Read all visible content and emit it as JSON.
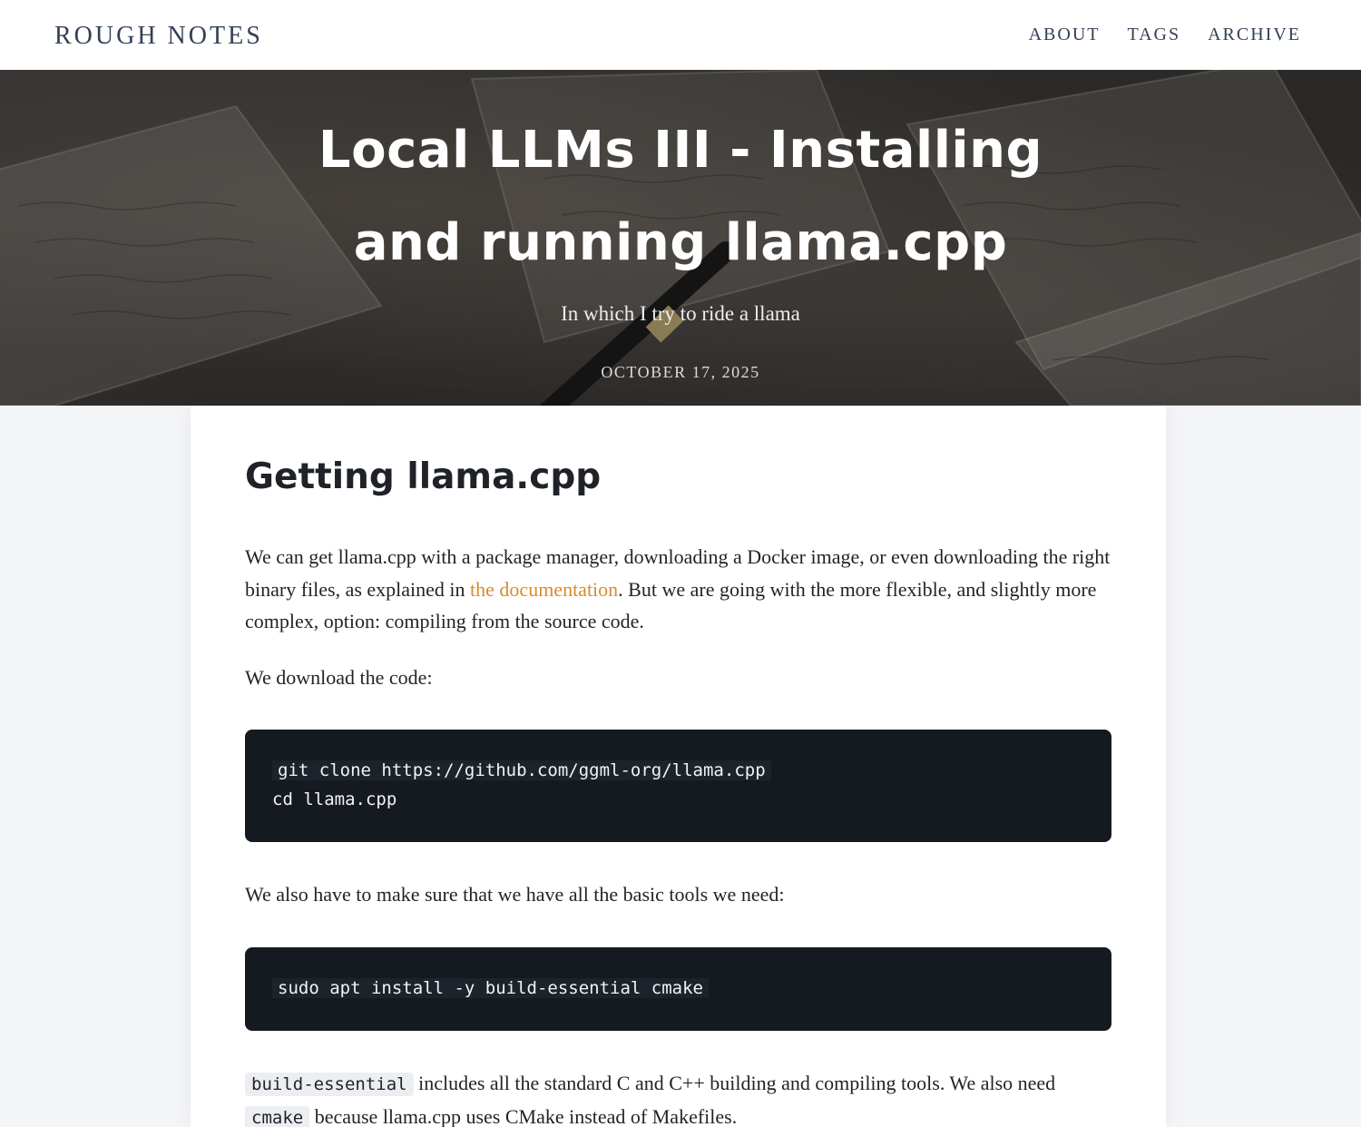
{
  "nav": {
    "brand": "ROUGH NOTES",
    "links": [
      "ABOUT",
      "TAGS",
      "ARCHIVE"
    ]
  },
  "hero": {
    "title_line1": "Local LLMs III - Installing",
    "title_line2": "and running llama.cpp",
    "subtitle": "In which I try to ride a llama",
    "date": "OCTOBER 17, 2025"
  },
  "article": {
    "heading": "Getting llama.cpp",
    "para1_before": "We can get llama.cpp with a package manager, downloading a Docker image, or even downloading the right binary files, as explained in ",
    "para1_link": "the documentation",
    "para1_after": ". But we are going with the more flexible, and slightly more complex, option: compiling from the source code.",
    "para2": "We download the code:",
    "code1": [
      "git clone https://github.com/ggml-org/llama.cpp",
      "cd llama.cpp"
    ],
    "para3": "We also have to make sure that we have all the basic tools we need:",
    "code2": [
      "sudo apt install -y build-essential cmake"
    ],
    "para4_code1": "build-essential",
    "para4_text1": " includes all the standard C and C++ building and compiling tools. We also need ",
    "para4_code2": "cmake",
    "para4_text2": " because llama.cpp uses CMake instead of Makefiles."
  },
  "colors": {
    "link": "#d98b2b",
    "code_bg": "#151a21",
    "page_bg": "#f4f5f7"
  }
}
